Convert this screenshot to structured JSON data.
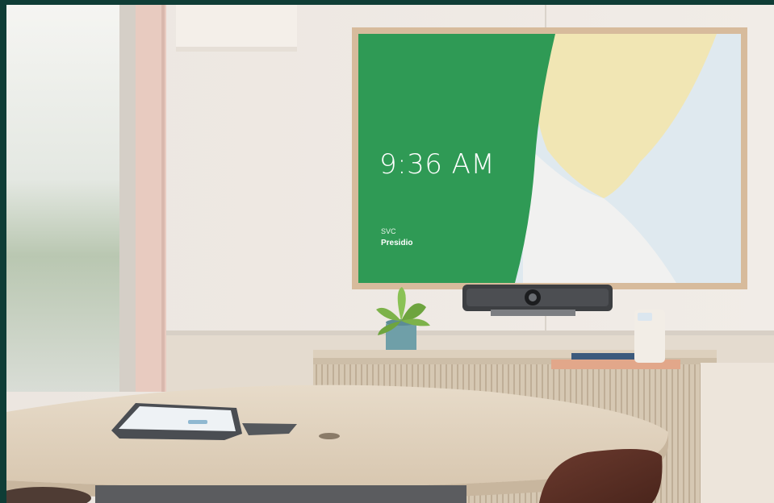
{
  "display": {
    "time": "9:36 AM",
    "org": "SVC",
    "room_name": "Presidio"
  },
  "colors": {
    "border": "#0f3d36",
    "screen_green": "#2f9a55",
    "screen_yellow": "#f1e6b4",
    "screen_blue": "#dfe9ef",
    "wall": "#ebe5df",
    "table_top": "#e3d5c2"
  }
}
